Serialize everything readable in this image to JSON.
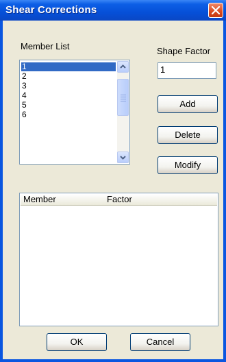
{
  "window": {
    "title": "Shear Corrections"
  },
  "member_list": {
    "label": "Member List",
    "items": [
      "1",
      "2",
      "3",
      "4",
      "5",
      "6"
    ],
    "selected": "1"
  },
  "shape_factor": {
    "label": "Shape Factor",
    "value": "1"
  },
  "buttons": {
    "add": "Add",
    "delete": "Delete",
    "modify": "Modify",
    "ok": "OK",
    "cancel": "Cancel"
  },
  "table": {
    "columns": [
      "Member",
      "Factor"
    ],
    "rows": []
  },
  "colors": {
    "title_bar": "#0a56e0",
    "selection": "#316ac5",
    "dialog_bg": "#ece9d8"
  }
}
